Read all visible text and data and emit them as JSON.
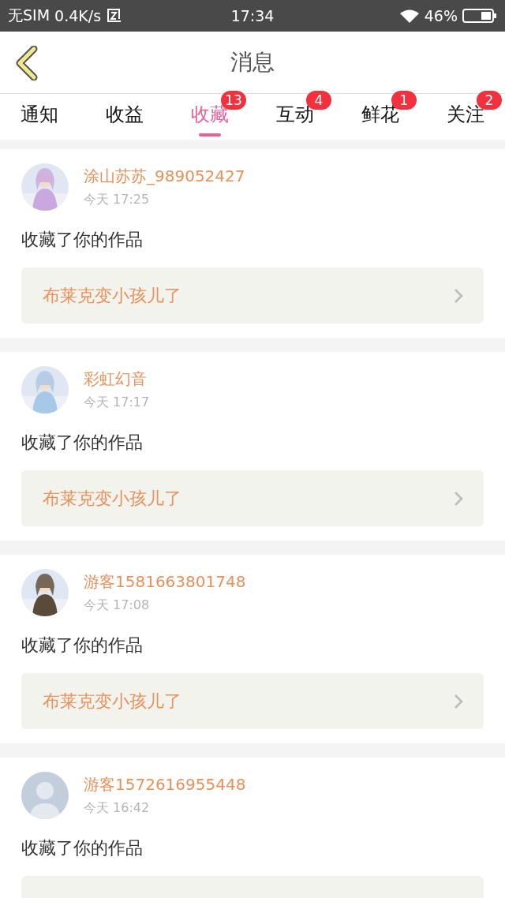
{
  "status_bar": {
    "carrier": "无SIM",
    "speed": "0.4K/s",
    "time": "17:34",
    "battery": "46%"
  },
  "header": {
    "title": "消息"
  },
  "tabs": [
    {
      "label": "通知",
      "selected": false
    },
    {
      "label": "收益",
      "selected": false
    },
    {
      "label": "收藏",
      "selected": true,
      "badge": "13"
    },
    {
      "label": "互动",
      "selected": false,
      "badge": "4"
    },
    {
      "label": "鲜花",
      "selected": false,
      "badge": "1"
    },
    {
      "label": "关注",
      "selected": false,
      "badge": "2"
    }
  ],
  "messages": [
    {
      "name": "涂山苏苏_989052427",
      "time": "今天 17:25",
      "text": "收藏了你的作品",
      "work": "布莱克变小孩儿了"
    },
    {
      "name": "彩虹幻音",
      "time": "今天 17:17",
      "text": "收藏了你的作品",
      "work": "布莱克变小孩儿了"
    },
    {
      "name": "游客1581663801748",
      "time": "今天 17:08",
      "text": "收藏了你的作品",
      "work": "布莱克变小孩儿了"
    },
    {
      "avatar": {
        "kind": "silhouette"
      },
      "name": "游客1572616955448",
      "time": "今天 16:42",
      "text": "收藏了你的作品"
    }
  ]
}
